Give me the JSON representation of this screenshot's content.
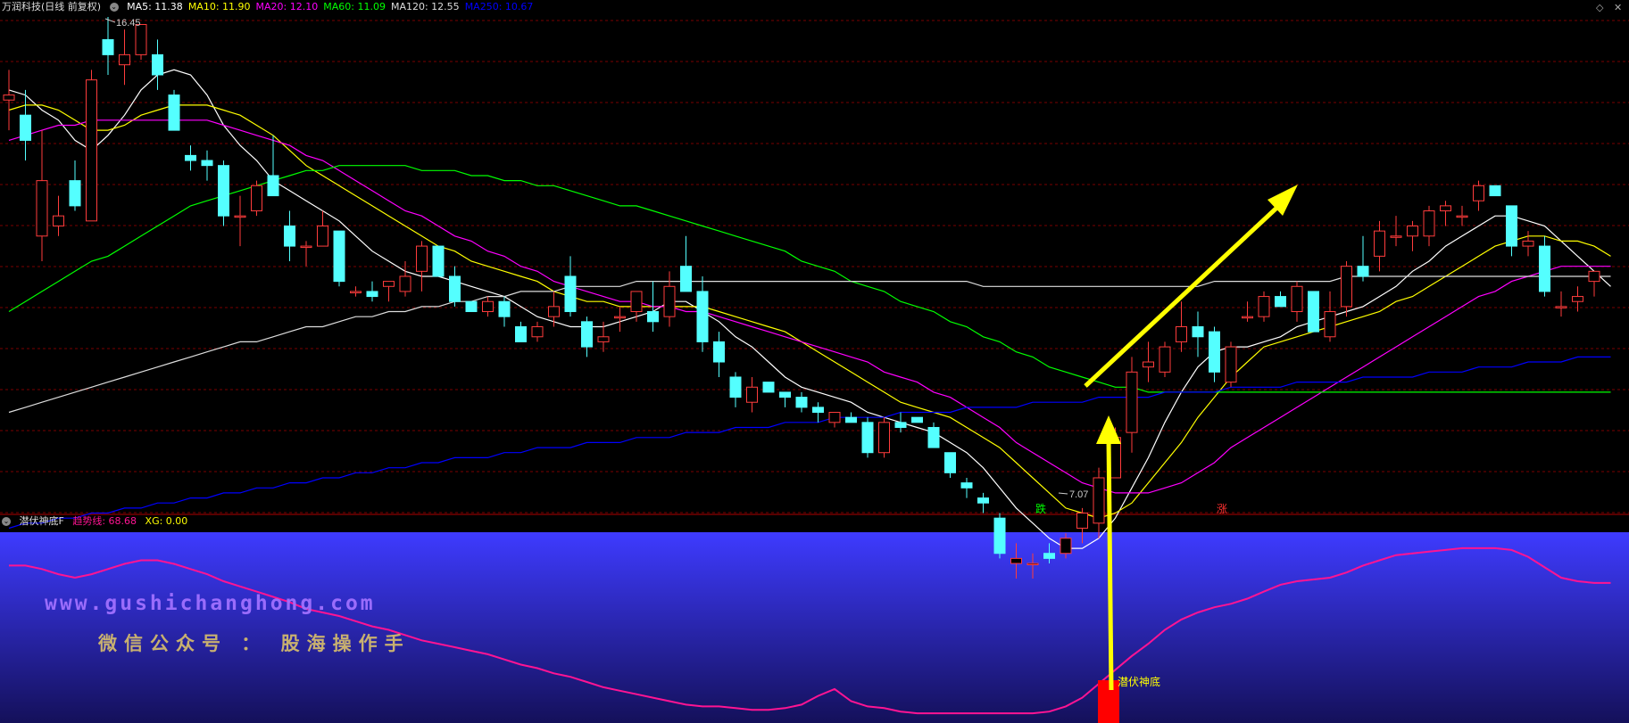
{
  "main_panel": {
    "stock_title": "万润科技(日线 前复权)",
    "ma_legend": [
      {
        "label": "MA5: 11.38",
        "color": "#ffffff"
      },
      {
        "label": "MA10: 11.90",
        "color": "#ffff00"
      },
      {
        "label": "MA20: 12.10",
        "color": "#ff00ff"
      },
      {
        "label": "MA60: 11.09",
        "color": "#00ff00"
      },
      {
        "label": "MA120: 12.55",
        "color": "#dddddd"
      },
      {
        "label": "MA250: 10.67",
        "color": "#0000ff"
      }
    ],
    "high_label": "16.45",
    "low_label": "7.07",
    "marker_down": "跌",
    "marker_up": "涨"
  },
  "indicator_panel": {
    "title": "潜伏神底F",
    "trend_label": "趋势线: 68.68",
    "xg_label": "XG: 0.00",
    "signal_label": "潜伏神底"
  },
  "watermark": {
    "url": "www.gushichanghong.com",
    "wechat": "微信公众号 ： 股海操作手"
  },
  "chart_data": {
    "type": "candlestick",
    "price_range": [
      7.07,
      16.45
    ],
    "candles": [
      [
        14.8,
        15.4,
        14.2,
        14.9
      ],
      [
        14.5,
        15.0,
        13.6,
        14.0
      ],
      [
        12.1,
        14.2,
        11.6,
        13.2
      ],
      [
        12.3,
        12.9,
        12.1,
        12.5
      ],
      [
        13.2,
        13.6,
        12.6,
        12.7
      ],
      [
        12.4,
        15.4,
        12.4,
        15.2
      ],
      [
        16.0,
        16.45,
        15.3,
        15.7
      ],
      [
        15.5,
        16.2,
        15.1,
        15.7
      ],
      [
        15.7,
        16.3,
        15.6,
        16.3
      ],
      [
        15.7,
        16.0,
        15.0,
        15.3
      ],
      [
        14.9,
        15.0,
        14.2,
        14.2
      ],
      [
        13.7,
        13.9,
        13.4,
        13.6
      ],
      [
        13.6,
        13.8,
        13.2,
        13.5
      ],
      [
        13.5,
        13.6,
        12.3,
        12.5
      ],
      [
        12.5,
        12.9,
        11.9,
        12.5
      ],
      [
        12.6,
        13.2,
        12.5,
        13.1
      ],
      [
        13.3,
        14.1,
        12.9,
        12.9
      ],
      [
        12.3,
        12.6,
        11.6,
        11.9
      ],
      [
        11.9,
        12.0,
        11.5,
        11.9
      ],
      [
        11.9,
        12.6,
        11.9,
        12.3
      ],
      [
        12.2,
        12.2,
        11.1,
        11.2
      ],
      [
        11.0,
        11.1,
        10.9,
        11.0
      ],
      [
        11.0,
        11.2,
        10.8,
        10.9
      ],
      [
        11.1,
        11.2,
        10.8,
        11.2
      ],
      [
        11.0,
        11.6,
        10.9,
        11.3
      ],
      [
        11.4,
        12.0,
        11.0,
        11.9
      ],
      [
        11.9,
        11.9,
        11.3,
        11.3
      ],
      [
        11.3,
        11.5,
        10.7,
        10.8
      ],
      [
        10.8,
        10.8,
        10.6,
        10.6
      ],
      [
        10.6,
        10.9,
        10.5,
        10.8
      ],
      [
        10.8,
        10.9,
        10.3,
        10.5
      ],
      [
        10.3,
        10.4,
        10.0,
        10.0
      ],
      [
        10.1,
        10.4,
        10.0,
        10.3
      ],
      [
        10.5,
        11.0,
        10.3,
        10.7
      ],
      [
        11.3,
        11.7,
        10.5,
        10.6
      ],
      [
        10.4,
        10.5,
        9.7,
        9.9
      ],
      [
        10.0,
        10.4,
        9.8,
        10.1
      ],
      [
        10.5,
        10.7,
        10.2,
        10.5
      ],
      [
        10.6,
        11.0,
        10.4,
        11.0
      ],
      [
        10.6,
        11.2,
        10.2,
        10.4
      ],
      [
        10.5,
        11.4,
        10.3,
        11.1
      ],
      [
        11.5,
        12.1,
        11.0,
        11.0
      ],
      [
        11.0,
        11.3,
        9.8,
        10.0
      ],
      [
        10.0,
        10.2,
        9.3,
        9.6
      ],
      [
        9.3,
        9.4,
        8.7,
        8.9
      ],
      [
        8.8,
        9.3,
        8.6,
        9.1
      ],
      [
        9.2,
        9.2,
        9.0,
        9.0
      ],
      [
        9.0,
        9.0,
        8.7,
        8.9
      ],
      [
        8.9,
        9.0,
        8.6,
        8.7
      ],
      [
        8.7,
        8.8,
        8.4,
        8.6
      ],
      [
        8.4,
        8.6,
        8.3,
        8.6
      ],
      [
        8.5,
        8.6,
        8.4,
        8.4
      ],
      [
        8.4,
        8.5,
        7.7,
        7.8
      ],
      [
        7.8,
        8.5,
        7.7,
        8.4
      ],
      [
        8.4,
        8.6,
        8.2,
        8.3
      ],
      [
        8.5,
        8.5,
        8.4,
        8.4
      ],
      [
        8.3,
        8.4,
        7.9,
        7.9
      ],
      [
        7.8,
        7.8,
        7.3,
        7.4
      ],
      [
        7.2,
        7.3,
        6.9,
        7.1
      ],
      [
        6.9,
        7.0,
        6.6,
        6.8
      ],
      [
        6.5,
        6.6,
        5.7,
        5.8
      ],
      [
        5.6,
        6.0,
        5.3,
        5.7
      ],
      [
        5.6,
        5.8,
        5.3,
        5.6
      ],
      [
        5.8,
        6.0,
        5.6,
        5.7
      ],
      [
        5.8,
        6.2,
        5.7,
        6.1
      ],
      [
        6.3,
        6.7,
        6.0,
        6.6
      ],
      [
        6.4,
        7.5,
        6.1,
        7.3
      ],
      [
        7.3,
        8.3,
        7.3,
        8.1
      ],
      [
        8.2,
        9.7,
        7.8,
        9.4
      ],
      [
        9.5,
        10.0,
        9.2,
        9.6
      ],
      [
        9.4,
        10.0,
        9.3,
        9.9
      ],
      [
        10.0,
        10.8,
        9.8,
        10.3
      ],
      [
        10.3,
        10.6,
        9.7,
        10.1
      ],
      [
        10.2,
        10.3,
        9.2,
        9.4
      ],
      [
        9.2,
        10.0,
        9.1,
        9.9
      ],
      [
        10.5,
        10.8,
        10.4,
        10.5
      ],
      [
        10.5,
        11.0,
        10.4,
        10.9
      ],
      [
        10.9,
        11.0,
        10.7,
        10.7
      ],
      [
        10.6,
        11.2,
        10.4,
        11.1
      ],
      [
        11.0,
        11.0,
        10.2,
        10.2
      ],
      [
        10.1,
        11.0,
        10.0,
        10.6
      ],
      [
        10.7,
        11.6,
        10.5,
        11.5
      ],
      [
        11.5,
        12.1,
        11.2,
        11.3
      ],
      [
        11.7,
        12.4,
        11.4,
        12.2
      ],
      [
        12.1,
        12.5,
        11.9,
        12.1
      ],
      [
        12.1,
        12.4,
        11.8,
        12.3
      ],
      [
        12.1,
        12.7,
        11.9,
        12.6
      ],
      [
        12.6,
        12.8,
        12.3,
        12.7
      ],
      [
        12.5,
        12.7,
        12.3,
        12.5
      ],
      [
        12.8,
        13.2,
        12.6,
        13.1
      ],
      [
        13.1,
        13.1,
        12.9,
        12.9
      ],
      [
        12.7,
        12.7,
        11.7,
        11.9
      ],
      [
        11.9,
        12.2,
        11.7,
        12.0
      ],
      [
        11.9,
        12.1,
        10.9,
        11.0
      ],
      [
        10.7,
        11.0,
        10.5,
        10.7
      ],
      [
        10.8,
        11.1,
        10.6,
        10.9
      ],
      [
        11.2,
        11.4,
        10.9,
        11.4
      ]
    ],
    "ma_series": [
      {
        "name": "MA5",
        "color": "#ffffff",
        "values": [
          15.0,
          14.9,
          14.6,
          14.4,
          14.0,
          13.8,
          14.1,
          14.5,
          15.0,
          15.3,
          15.4,
          15.3,
          14.9,
          14.3,
          13.9,
          13.6,
          13.2,
          13.0,
          12.8,
          12.6,
          12.4,
          12.1,
          11.8,
          11.6,
          11.4,
          11.3,
          11.3,
          11.2,
          11.1,
          11.0,
          10.9,
          10.7,
          10.5,
          10.4,
          10.3,
          10.3,
          10.3,
          10.4,
          10.5,
          10.6,
          10.8,
          10.8,
          10.6,
          10.4,
          10.1,
          9.9,
          9.6,
          9.3,
          9.1,
          9.0,
          8.9,
          8.8,
          8.6,
          8.5,
          8.4,
          8.3,
          8.2,
          8.0,
          7.8,
          7.5,
          7.1,
          6.7,
          6.4,
          6.1,
          5.9,
          5.9,
          6.1,
          6.5,
          7.1,
          7.7,
          8.4,
          9.0,
          9.5,
          9.8,
          9.9,
          9.9,
          10.0,
          10.1,
          10.3,
          10.4,
          10.5,
          10.6,
          10.7,
          10.9,
          11.1,
          11.4,
          11.6,
          11.9,
          12.1,
          12.3,
          12.5,
          12.5,
          12.4,
          12.3,
          12.0,
          11.7,
          11.4,
          11.1
        ]
      },
      {
        "name": "MA10",
        "color": "#ffff00",
        "values": [
          14.6,
          14.7,
          14.7,
          14.6,
          14.4,
          14.2,
          14.2,
          14.3,
          14.5,
          14.6,
          14.7,
          14.7,
          14.7,
          14.6,
          14.5,
          14.3,
          14.1,
          13.8,
          13.5,
          13.3,
          13.1,
          12.9,
          12.7,
          12.5,
          12.3,
          12.1,
          11.9,
          11.8,
          11.6,
          11.5,
          11.4,
          11.3,
          11.2,
          11.0,
          10.9,
          10.8,
          10.8,
          10.7,
          10.7,
          10.7,
          10.7,
          10.7,
          10.7,
          10.6,
          10.5,
          10.4,
          10.3,
          10.2,
          10.0,
          9.8,
          9.6,
          9.4,
          9.2,
          9.0,
          8.8,
          8.7,
          8.6,
          8.5,
          8.3,
          8.1,
          7.9,
          7.6,
          7.3,
          7.0,
          6.7,
          6.6,
          6.5,
          6.6,
          6.8,
          7.2,
          7.6,
          8.0,
          8.5,
          8.9,
          9.3,
          9.6,
          9.9,
          10.0,
          10.1,
          10.2,
          10.3,
          10.4,
          10.5,
          10.6,
          10.8,
          10.9,
          11.1,
          11.3,
          11.5,
          11.7,
          11.9,
          12.0,
          12.1,
          12.1,
          12.0,
          12.0,
          11.9,
          11.7
        ]
      },
      {
        "name": "MA20",
        "color": "#ff00ff",
        "values": [
          14.0,
          14.1,
          14.2,
          14.3,
          14.3,
          14.4,
          14.4,
          14.4,
          14.4,
          14.4,
          14.4,
          14.4,
          14.4,
          14.3,
          14.2,
          14.1,
          14.0,
          13.9,
          13.7,
          13.6,
          13.4,
          13.2,
          13.0,
          12.8,
          12.6,
          12.5,
          12.3,
          12.1,
          12.0,
          11.8,
          11.7,
          11.5,
          11.4,
          11.2,
          11.1,
          11.0,
          10.9,
          10.8,
          10.8,
          10.7,
          10.7,
          10.6,
          10.6,
          10.5,
          10.4,
          10.3,
          10.2,
          10.1,
          10.0,
          9.9,
          9.8,
          9.7,
          9.6,
          9.4,
          9.3,
          9.2,
          9.0,
          8.9,
          8.7,
          8.5,
          8.3,
          8.0,
          7.8,
          7.6,
          7.4,
          7.2,
          7.1,
          7.0,
          7.0,
          7.0,
          7.1,
          7.2,
          7.4,
          7.6,
          7.9,
          8.1,
          8.3,
          8.5,
          8.7,
          8.9,
          9.1,
          9.3,
          9.5,
          9.7,
          9.9,
          10.1,
          10.3,
          10.5,
          10.7,
          10.9,
          11.0,
          11.2,
          11.3,
          11.4,
          11.5,
          11.5,
          11.5,
          11.5
        ]
      },
      {
        "name": "MA60",
        "color": "#00ff00",
        "values": [
          10.6,
          10.8,
          11.0,
          11.2,
          11.4,
          11.6,
          11.7,
          11.9,
          12.1,
          12.3,
          12.5,
          12.7,
          12.8,
          12.9,
          13.0,
          13.1,
          13.2,
          13.3,
          13.4,
          13.4,
          13.5,
          13.5,
          13.5,
          13.5,
          13.5,
          13.4,
          13.4,
          13.4,
          13.3,
          13.3,
          13.2,
          13.2,
          13.1,
          13.1,
          13.0,
          12.9,
          12.8,
          12.7,
          12.7,
          12.6,
          12.5,
          12.4,
          12.3,
          12.2,
          12.1,
          12.0,
          11.9,
          11.8,
          11.6,
          11.5,
          11.4,
          11.2,
          11.1,
          11.0,
          10.8,
          10.7,
          10.6,
          10.4,
          10.3,
          10.1,
          10.0,
          9.8,
          9.7,
          9.5,
          9.4,
          9.3,
          9.2,
          9.1,
          9.1,
          9.0,
          9.0,
          9.0,
          9.0,
          9.0,
          9.0,
          9.0,
          9.0,
          9.0,
          9.0,
          9.0,
          9.0,
          9.0,
          9.0,
          9.0,
          9.0,
          9.0,
          9.0,
          9.0,
          9.0,
          9.0,
          9.0,
          9.0,
          9.0,
          9.0,
          9.0,
          9.0,
          9.0,
          9.0
        ]
      },
      {
        "name": "MA120",
        "color": "#dddddd",
        "values": [
          8.6,
          8.7,
          8.8,
          8.9,
          9.0,
          9.1,
          9.2,
          9.3,
          9.4,
          9.5,
          9.6,
          9.7,
          9.8,
          9.9,
          10.0,
          10.0,
          10.1,
          10.2,
          10.3,
          10.3,
          10.4,
          10.5,
          10.5,
          10.6,
          10.6,
          10.7,
          10.7,
          10.8,
          10.8,
          10.9,
          10.9,
          11.0,
          11.0,
          11.0,
          11.1,
          11.1,
          11.1,
          11.1,
          11.2,
          11.2,
          11.2,
          11.2,
          11.2,
          11.2,
          11.2,
          11.2,
          11.2,
          11.2,
          11.2,
          11.2,
          11.2,
          11.2,
          11.2,
          11.2,
          11.2,
          11.2,
          11.2,
          11.2,
          11.2,
          11.1,
          11.1,
          11.1,
          11.1,
          11.1,
          11.1,
          11.1,
          11.1,
          11.1,
          11.1,
          11.1,
          11.1,
          11.1,
          11.1,
          11.2,
          11.2,
          11.2,
          11.2,
          11.2,
          11.2,
          11.2,
          11.2,
          11.3,
          11.3,
          11.3,
          11.3,
          11.3,
          11.3,
          11.3,
          11.3,
          11.3,
          11.3,
          11.3,
          11.3,
          11.3,
          11.3,
          11.3,
          11.3,
          11.3
        ]
      },
      {
        "name": "MA250",
        "color": "#0000ff",
        "values": [
          6.3,
          6.4,
          6.4,
          6.5,
          6.5,
          6.6,
          6.6,
          6.7,
          6.7,
          6.8,
          6.8,
          6.9,
          6.9,
          7.0,
          7.0,
          7.1,
          7.1,
          7.2,
          7.2,
          7.3,
          7.3,
          7.4,
          7.4,
          7.5,
          7.5,
          7.6,
          7.6,
          7.7,
          7.7,
          7.7,
          7.8,
          7.8,
          7.9,
          7.9,
          7.9,
          8.0,
          8.0,
          8.0,
          8.1,
          8.1,
          8.1,
          8.2,
          8.2,
          8.2,
          8.3,
          8.3,
          8.3,
          8.4,
          8.4,
          8.4,
          8.5,
          8.5,
          8.5,
          8.5,
          8.6,
          8.6,
          8.6,
          8.6,
          8.7,
          8.7,
          8.7,
          8.7,
          8.8,
          8.8,
          8.8,
          8.8,
          8.9,
          8.9,
          8.9,
          8.9,
          9.0,
          9.0,
          9.0,
          9.0,
          9.1,
          9.1,
          9.1,
          9.1,
          9.2,
          9.2,
          9.2,
          9.2,
          9.3,
          9.3,
          9.3,
          9.3,
          9.4,
          9.4,
          9.4,
          9.5,
          9.5,
          9.5,
          9.6,
          9.6,
          9.6,
          9.7,
          9.7,
          9.7
        ]
      }
    ],
    "indicator": {
      "name": "趋势线",
      "range": [
        0,
        100
      ],
      "values": [
        88,
        88,
        86,
        83,
        81,
        83,
        86,
        89,
        91,
        91,
        89,
        86,
        83,
        79,
        76,
        73,
        70,
        67,
        63,
        61,
        59,
        56,
        53,
        51,
        48,
        45,
        43,
        41,
        39,
        37,
        34,
        31,
        29,
        26,
        24,
        21,
        18,
        16,
        14,
        12,
        10,
        8,
        7,
        7,
        6,
        5,
        5,
        6,
        8,
        13,
        17,
        10,
        7,
        6,
        4,
        3,
        3,
        3,
        3,
        3,
        3,
        3,
        3,
        4,
        7,
        12,
        20,
        28,
        36,
        43,
        51,
        57,
        61,
        64,
        66,
        69,
        73,
        77,
        79,
        80,
        81,
        84,
        88,
        91,
        94,
        95,
        96,
        97,
        98,
        98,
        98,
        97,
        93,
        87,
        81,
        79,
        78,
        78
      ]
    }
  }
}
